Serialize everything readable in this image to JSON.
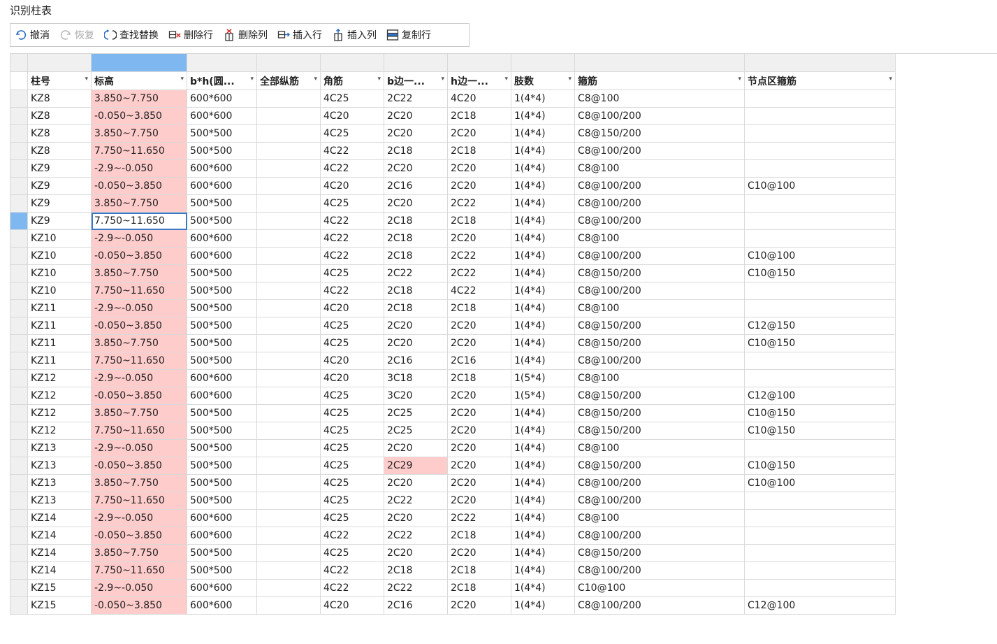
{
  "window": {
    "title": "识别柱表"
  },
  "toolbar": [
    {
      "label": "撤消",
      "icon": "undo-icon",
      "enabled": true
    },
    {
      "label": "恢复",
      "icon": "redo-icon",
      "enabled": false
    },
    {
      "label": "查找替换",
      "icon": "find-replace-icon",
      "enabled": true
    },
    {
      "label": "删除行",
      "icon": "delete-row-icon",
      "enabled": true
    },
    {
      "label": "删除列",
      "icon": "delete-column-icon",
      "enabled": true
    },
    {
      "label": "插入行",
      "icon": "insert-row-icon",
      "enabled": true
    },
    {
      "label": "插入列",
      "icon": "insert-column-icon",
      "enabled": true
    },
    {
      "label": "复制行",
      "icon": "copy-row-icon",
      "enabled": true
    }
  ],
  "table": {
    "columns": [
      "柱号",
      "标高",
      "b*h(圆...",
      "全部纵筋",
      "角筋",
      "b边一...",
      "h边一...",
      "肢数",
      "箍筋",
      "节点区箍筋"
    ],
    "selected_column": 1,
    "selected_row": 7,
    "highlight_color": "#ffcccc",
    "selection_color": "#7fb8f0",
    "error_cells": [
      [
        21,
        5
      ]
    ],
    "rows": [
      [
        "KZ8",
        "3.850~7.750",
        "600*600",
        "",
        "4C25",
        "2C22",
        "4C20",
        "1(4*4)",
        "C8@100",
        ""
      ],
      [
        "KZ8",
        "-0.050~3.850",
        "600*600",
        "",
        "4C20",
        "2C20",
        "2C18",
        "1(4*4)",
        "C8@100/200",
        ""
      ],
      [
        "KZ8",
        "3.850~7.750",
        "500*500",
        "",
        "4C25",
        "2C20",
        "2C20",
        "1(4*4)",
        "C8@150/200",
        ""
      ],
      [
        "KZ8",
        "7.750~11.650",
        "500*500",
        "",
        "4C22",
        "2C18",
        "2C18",
        "1(4*4)",
        "C8@100/200",
        ""
      ],
      [
        "KZ9",
        "-2.9~-0.050",
        "600*600",
        "",
        "4C22",
        "2C20",
        "2C20",
        "1(4*4)",
        "C8@100",
        ""
      ],
      [
        "KZ9",
        "-0.050~3.850",
        "600*600",
        "",
        "4C20",
        "2C16",
        "2C20",
        "1(4*4)",
        "C8@100/200",
        "C10@100"
      ],
      [
        "KZ9",
        "3.850~7.750",
        "500*500",
        "",
        "4C25",
        "2C20",
        "2C22",
        "1(4*4)",
        "C8@100/200",
        ""
      ],
      [
        "KZ9",
        "7.750~11.650",
        "500*500",
        "",
        "4C22",
        "2C18",
        "2C18",
        "1(4*4)",
        "C8@100/200",
        ""
      ],
      [
        "KZ10",
        "-2.9~-0.050",
        "600*600",
        "",
        "4C22",
        "2C18",
        "2C20",
        "1(4*4)",
        "C8@100",
        ""
      ],
      [
        "KZ10",
        "-0.050~3.850",
        "600*600",
        "",
        "4C22",
        "2C18",
        "2C22",
        "1(4*4)",
        "C8@100/200",
        "C10@100"
      ],
      [
        "KZ10",
        "3.850~7.750",
        "500*500",
        "",
        "4C25",
        "2C22",
        "2C22",
        "1(4*4)",
        "C8@150/200",
        "C10@150"
      ],
      [
        "KZ10",
        "7.750~11.650",
        "500*500",
        "",
        "4C22",
        "2C18",
        "4C22",
        "1(4*4)",
        "C8@100/200",
        ""
      ],
      [
        "KZ11",
        "-2.9~-0.050",
        "500*500",
        "",
        "4C20",
        "2C18",
        "2C18",
        "1(4*4)",
        "C8@100",
        ""
      ],
      [
        "KZ11",
        "-0.050~3.850",
        "500*500",
        "",
        "4C25",
        "2C20",
        "2C20",
        "1(4*4)",
        "C8@150/200",
        "C12@150"
      ],
      [
        "KZ11",
        "3.850~7.750",
        "500*500",
        "",
        "4C25",
        "2C20",
        "2C20",
        "1(4*4)",
        "C8@150/200",
        "C10@150"
      ],
      [
        "KZ11",
        "7.750~11.650",
        "500*500",
        "",
        "4C20",
        "2C16",
        "2C16",
        "1(4*4)",
        "C8@100/200",
        ""
      ],
      [
        "KZ12",
        "-2.9~-0.050",
        "600*600",
        "",
        "4C20",
        "3C18",
        "2C18",
        "1(5*4)",
        "C8@100",
        ""
      ],
      [
        "KZ12",
        "-0.050~3.850",
        "600*600",
        "",
        "4C25",
        "3C20",
        "2C20",
        "1(5*4)",
        "C8@150/200",
        "C12@100"
      ],
      [
        "KZ12",
        "3.850~7.750",
        "500*500",
        "",
        "4C25",
        "2C25",
        "2C20",
        "1(4*4)",
        "C8@150/200",
        "C10@150"
      ],
      [
        "KZ12",
        "7.750~11.650",
        "500*500",
        "",
        "4C25",
        "2C25",
        "2C20",
        "1(4*4)",
        "C8@150/200",
        "C10@150"
      ],
      [
        "KZ13",
        "-2.9~-0.050",
        "500*500",
        "",
        "4C25",
        "2C20",
        "2C20",
        "1(4*4)",
        "C8@100",
        ""
      ],
      [
        "KZ13",
        "-0.050~3.850",
        "500*500",
        "",
        "4C25",
        "2C29",
        "2C20",
        "1(4*4)",
        "C8@150/200",
        "C10@150"
      ],
      [
        "KZ13",
        "3.850~7.750",
        "500*500",
        "",
        "4C25",
        "2C20",
        "2C20",
        "1(4*4)",
        "C8@100/200",
        "C10@100"
      ],
      [
        "KZ13",
        "7.750~11.650",
        "500*500",
        "",
        "4C25",
        "2C22",
        "2C20",
        "1(4*4)",
        "C8@100/200",
        ""
      ],
      [
        "KZ14",
        "-2.9~-0.050",
        "600*600",
        "",
        "4C25",
        "2C20",
        "2C22",
        "1(4*4)",
        "C8@100",
        ""
      ],
      [
        "KZ14",
        "-0.050~3.850",
        "600*600",
        "",
        "4C22",
        "2C22",
        "2C18",
        "1(4*4)",
        "C8@100/200",
        ""
      ],
      [
        "KZ14",
        "3.850~7.750",
        "500*500",
        "",
        "4C25",
        "2C20",
        "2C20",
        "1(4*4)",
        "C8@150/200",
        ""
      ],
      [
        "KZ14",
        "7.750~11.650",
        "500*500",
        "",
        "4C22",
        "2C18",
        "2C18",
        "1(4*4)",
        "C8@100/200",
        ""
      ],
      [
        "KZ15",
        "-2.9~-0.050",
        "600*600",
        "",
        "4C22",
        "2C22",
        "2C18",
        "1(4*4)",
        "C10@100",
        ""
      ],
      [
        "KZ15",
        "-0.050~3.850",
        "600*600",
        "",
        "4C20",
        "2C16",
        "2C20",
        "1(4*4)",
        "C8@100/200",
        "C12@100"
      ]
    ]
  }
}
